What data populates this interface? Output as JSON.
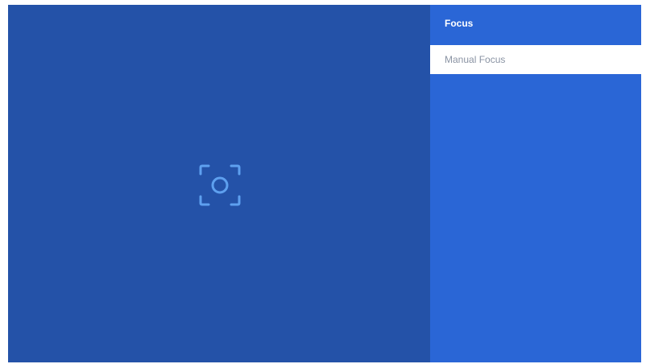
{
  "panel": {
    "title": "Focus",
    "items": [
      {
        "label": "Manual Focus",
        "selected": true
      }
    ]
  },
  "preview": {
    "indicator_icon": "focus-target-icon"
  },
  "colors": {
    "preview_background": "#2452a8",
    "panel_background": "#2a66d6",
    "icon_stroke": "#5ea0ef",
    "item_background": "#ffffff",
    "item_text": "#8a93a3"
  }
}
